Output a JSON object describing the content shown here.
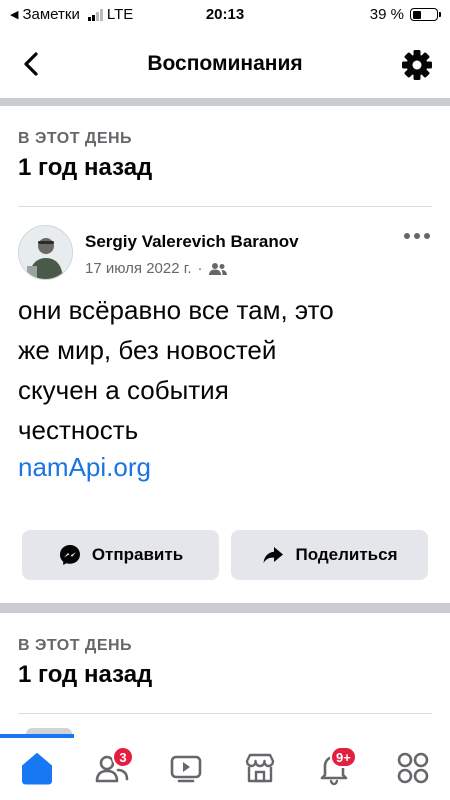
{
  "status_bar": {
    "back_app": "Заметки",
    "network": "LTE",
    "time": "20:13",
    "battery_text": "39 %",
    "battery_level": 0.39
  },
  "nav": {
    "title": "Воспоминания",
    "icons": {
      "back": "chevron-left-icon",
      "settings": "gear-icon"
    }
  },
  "sections": [
    {
      "day_label": "В ЭТОТ ДЕНЬ",
      "period": "1 год назад",
      "post": {
        "author": "Sergiy Valerevich Baranov",
        "date": "17 июля 2022 г.",
        "separator": "·",
        "audience_icon": "friends-icon",
        "lines": [
          "они всёравно все там, это",
          "же мир, без новостей",
          "скучен а события",
          "честность"
        ],
        "link": "namApi.org",
        "actions": {
          "send": "Отправить",
          "share": "Поделиться"
        }
      }
    },
    {
      "day_label": "В ЭТОТ ДЕНЬ",
      "period": "1 год назад"
    }
  ],
  "tabbar": {
    "tabs": [
      {
        "name": "home",
        "icon": "home-icon",
        "active": true
      },
      {
        "name": "friends",
        "icon": "friends-icon",
        "badge": "3"
      },
      {
        "name": "video",
        "icon": "video-icon"
      },
      {
        "name": "marketplace",
        "icon": "marketplace-icon"
      },
      {
        "name": "notifications",
        "icon": "bell-icon",
        "badge": "9+"
      },
      {
        "name": "menu",
        "icon": "menu-icon"
      }
    ],
    "colors": {
      "active": "#1877f2",
      "inactive": "#65676b",
      "badge": "#e41e3f"
    }
  }
}
